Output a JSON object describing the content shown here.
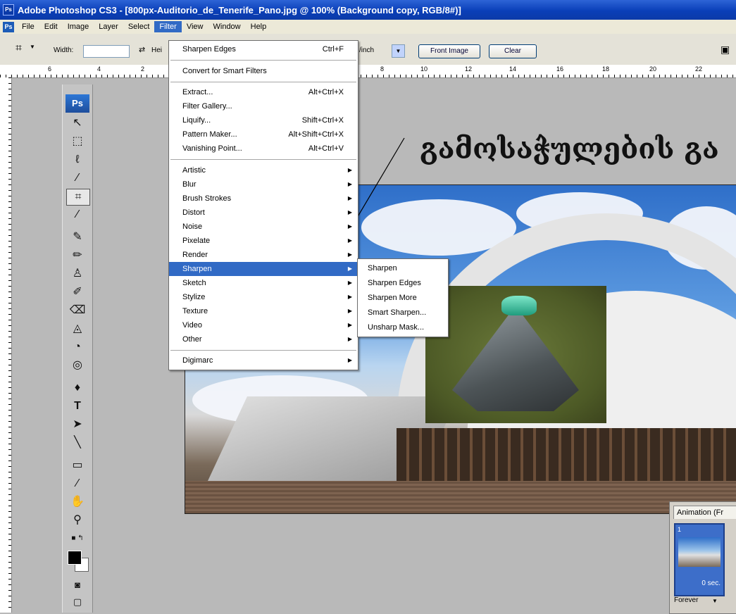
{
  "window": {
    "title": "Adobe Photoshop CS3 - [800px-Auditorio_de_Tenerife_Pano.jpg @ 100% (Background copy, RGB/8#)]",
    "app_icon": "ps-icon"
  },
  "menubar": {
    "items": [
      "File",
      "Edit",
      "Image",
      "Layer",
      "Select",
      "Filter",
      "View",
      "Window",
      "Help"
    ],
    "active": "Filter"
  },
  "options": {
    "width_label": "Width:",
    "height_label": "Hei",
    "resolution_unit": "/inch",
    "front_image_label": "Front Image",
    "clear_label": "Clear"
  },
  "ruler": {
    "labels": [
      "6",
      "4",
      "2",
      "8",
      "10",
      "12",
      "14",
      "16",
      "18",
      "20",
      "22"
    ]
  },
  "toolbox": {
    "logo": "Ps",
    "tools": [
      "move-tool-icon",
      "marquee-tool-icon",
      "lasso-tool-icon",
      "magic-wand-icon",
      "crop-tool-icon",
      "slice-tool-icon",
      "healing-brush-icon",
      "brush-tool-icon",
      "clone-stamp-icon",
      "history-brush-icon",
      "eraser-icon",
      "paint-bucket-icon",
      "blur-tool-icon",
      "dodge-tool-icon",
      "pen-tool-icon",
      "type-tool-icon",
      "path-selection-icon",
      "line-tool-icon",
      "notes-tool-icon",
      "eyedropper-icon",
      "hand-tool-icon",
      "zoom-tool-icon"
    ]
  },
  "filter_menu": {
    "last_filter": {
      "label": "Sharpen Edges",
      "shortcut": "Ctrl+F"
    },
    "smart": "Convert for Smart Filters",
    "tools": [
      {
        "label": "Extract...",
        "shortcut": "Alt+Ctrl+X"
      },
      {
        "label": "Filter Gallery...",
        "shortcut": ""
      },
      {
        "label": "Liquify...",
        "shortcut": "Shift+Ctrl+X"
      },
      {
        "label": "Pattern Maker...",
        "shortcut": "Alt+Shift+Ctrl+X"
      },
      {
        "label": "Vanishing Point...",
        "shortcut": "Alt+Ctrl+V"
      }
    ],
    "groups": [
      "Artistic",
      "Blur",
      "Brush Strokes",
      "Distort",
      "Noise",
      "Pixelate",
      "Render",
      "Sharpen",
      "Sketch",
      "Stylize",
      "Texture",
      "Video",
      "Other"
    ],
    "highlighted": "Sharpen",
    "digimarc": "Digimarc"
  },
  "sharpen_submenu": {
    "items": [
      "Sharpen",
      "Sharpen Edges",
      "Sharpen More",
      "Smart Sharpen...",
      "Unsharp Mask..."
    ]
  },
  "annotation": {
    "text": "გამოსაჭულების გა"
  },
  "animation_panel": {
    "tab": "Animation (Fr",
    "frame_number": "1",
    "frame_time": "0 sec.",
    "loop": "Forever"
  },
  "colors": {
    "titlebar": "#0a3fb8",
    "menu_highlight": "#316ac5",
    "workspace": "#b9b9b9"
  }
}
